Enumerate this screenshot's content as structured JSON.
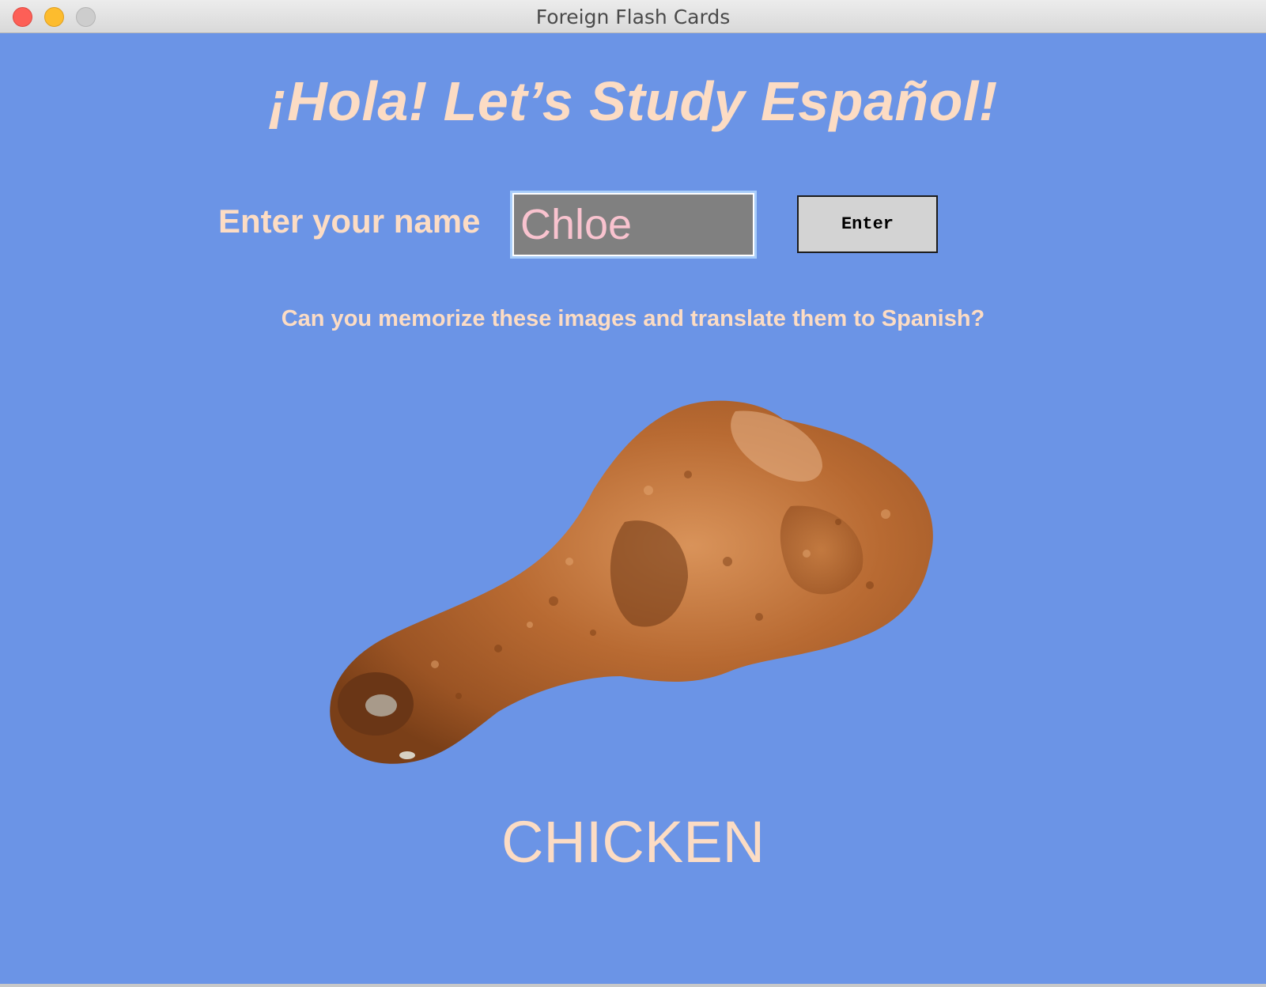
{
  "window": {
    "title": "Foreign Flash Cards"
  },
  "app": {
    "headline": "¡Hola! Let’s Study Español!",
    "name_prompt": "Enter your name",
    "name_value": "Chloe",
    "enter_label": "Enter",
    "instructions": "Can you memorize these images and translate them to Spanish?",
    "card": {
      "image": "fried-chicken-drumstick",
      "word": "CHICKEN"
    }
  },
  "colors": {
    "background": "#6b94e6",
    "text": "#fcdcc4",
    "field_bg": "#808080",
    "field_text": "#f9c3cf",
    "button_bg": "#d3d3d3"
  }
}
